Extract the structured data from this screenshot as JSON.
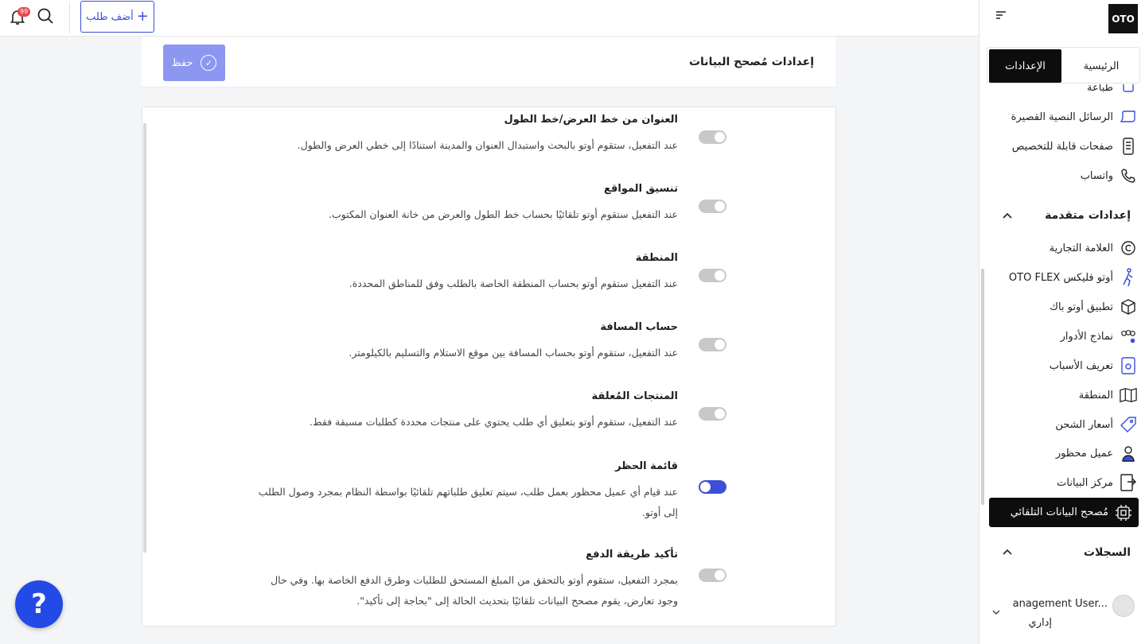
{
  "topbar": {
    "notification_count": "99",
    "add_order_label": "أضف طلب",
    "add_order_plus": "+"
  },
  "header": {
    "title": "إعدادات مُصحح البيانات",
    "save_label": "حفظ",
    "save_check": "✓"
  },
  "settings": [
    {
      "title": "العنوان من خط العرض/خط الطول",
      "description": "عند التفعيل، ستقوم أوتو بالبحث واستبدال العنوان والمدينة استنادًا إلى خطي العرض والطول.",
      "enabled": false
    },
    {
      "title": "تنسيق المواقع",
      "description": "عند التفعيل ستقوم أوتو تلقائيًا بحساب خط الطول والعرض من خانة العنوان المكتوب.",
      "enabled": false
    },
    {
      "title": "المنطقة",
      "description": "عند التفعيل ستقوم أوتو بحساب المنطقة الخاصة بالطلب وفق للمناطق المحددة.",
      "enabled": false
    },
    {
      "title": "حساب المسافة",
      "description": "عند التفعيل، ستقوم أوتو بحساب المسافة بين موقع الاستلام والتسليم بالكيلومتر.",
      "enabled": false
    },
    {
      "title": "المنتجات المُعلقة",
      "description": "عند التفعيل، ستقوم أوتو بتعليق أي طلب يحتوي على منتجات محددة كطلبات مسبقة فقط.",
      "enabled": false
    },
    {
      "title": "قائمة الحظر",
      "description": "عند قيام أي عميل محظور بعمل طلب، سيتم تعليق طلباتهم تلقائيًا بواسطة النظام بمجرد وصول الطلب إلى أوتو.",
      "enabled": true
    },
    {
      "title": "تأكيد طريقة الدفع",
      "description": "بمجرد التفعيل، ستقوم أوتو بالتحقق من المبلغ المستحق للطلبات وطرق الدفع الخاصة بها. وفي حال وجود تعارض، يقوم مصحح البيانات تلقائيًا بتحديث الحالة إلى \"بحاجة إلى تأكيد\".",
      "enabled": false
    }
  ],
  "sidebar": {
    "logo": "OTO",
    "tabs": {
      "home": "الرئيسية",
      "settings": "الإعدادات"
    },
    "items_top": [
      {
        "label": "طباعة",
        "icon": "printer-icon"
      },
      {
        "label": "الرسائل النصية القصيرة",
        "icon": "message-icon"
      },
      {
        "label": "صفحات قابلة للتخصيص",
        "icon": "phone-page-icon"
      },
      {
        "label": "واتساب",
        "icon": "phone-icon"
      }
    ],
    "advanced_title": "إعدادات متقدمة",
    "items_advanced": [
      {
        "label": "العلامة التجارية",
        "icon": "copyright-icon"
      },
      {
        "label": "أوتو فليكس OTO FLEX",
        "icon": "courier-icon"
      },
      {
        "label": "تطبيق أوتو باك",
        "icon": "box-icon"
      },
      {
        "label": "نماذج الأدوار",
        "icon": "users-icon"
      },
      {
        "label": "تعريف الأسباب",
        "icon": "gear-doc-icon"
      },
      {
        "label": "المنطقة",
        "icon": "map-icon"
      },
      {
        "label": "أسعار الشحن",
        "icon": "tag-icon"
      },
      {
        "label": "عميل محظور",
        "icon": "blocked-user-icon"
      },
      {
        "label": "مركز البيانات",
        "icon": "data-doc-icon"
      },
      {
        "label": "مُصحح البيانات التلقائي",
        "icon": "chip-icon"
      }
    ],
    "logs_title": "السجلات",
    "user": {
      "name": "anagement User...",
      "role": "إداري"
    }
  },
  "help_label": "?"
}
